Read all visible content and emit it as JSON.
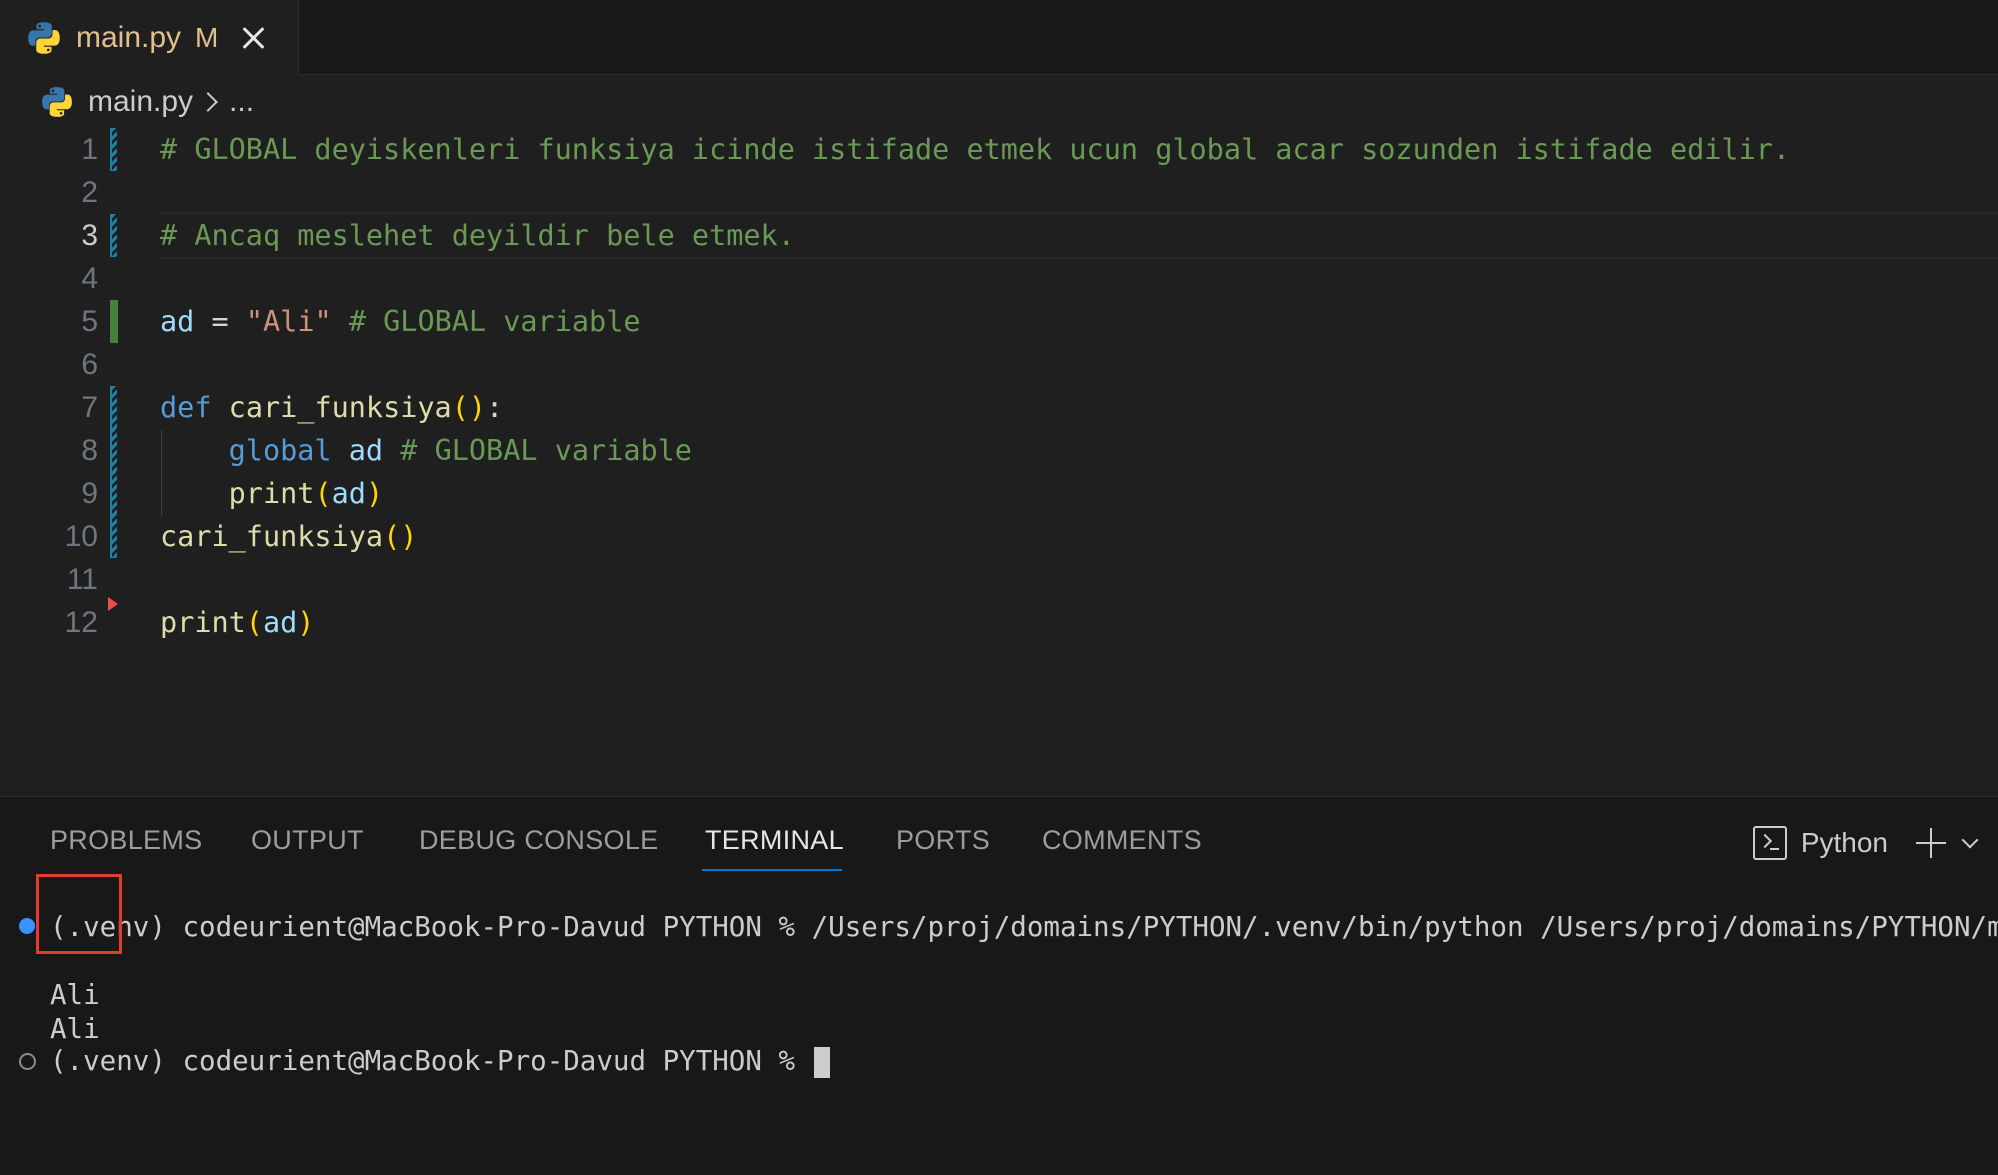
{
  "tab": {
    "filename": "main.py",
    "status": "M",
    "icon": "python-icon"
  },
  "breadcrumb": {
    "file": "main.py",
    "more": "..."
  },
  "editor": {
    "active_line": 3,
    "lines": [
      {
        "n": "1",
        "text": "# GLOBAL deyiskenleri funksiya icinde istifade etmek ucun global acar sozunden istifade edilir."
      },
      {
        "n": "2",
        "text": ""
      },
      {
        "n": "3",
        "text": "# Ancaq meslehet deyildir bele etmek."
      },
      {
        "n": "4",
        "text": ""
      },
      {
        "n": "5",
        "ad": "ad",
        "eq": "=",
        "str": "\"Ali\"",
        "comment": "# GLOBAL variable"
      },
      {
        "n": "6",
        "text": ""
      },
      {
        "n": "7",
        "kw": "def",
        "fn": "cari_funksiya",
        "parens": "()",
        "colon": ":"
      },
      {
        "n": "8",
        "kw": "global",
        "var": "ad",
        "comment": "# GLOBAL variable"
      },
      {
        "n": "9",
        "fn": "print",
        "open": "(",
        "var": "ad",
        "close": ")"
      },
      {
        "n": "10",
        "fn": "cari_funksiya",
        "parens": "()"
      },
      {
        "n": "11",
        "text": ""
      },
      {
        "n": "12",
        "fn": "print",
        "open": "(",
        "var": "ad",
        "close": ")"
      }
    ]
  },
  "panel": {
    "tabs": [
      "PROBLEMS",
      "OUTPUT",
      "DEBUG CONSOLE",
      "TERMINAL",
      "PORTS",
      "COMMENTS"
    ],
    "active_tab": "TERMINAL",
    "shell_label": "Python"
  },
  "terminal": {
    "command_line": "(.venv) codeurient@MacBook-Pro-Davud PYTHON % /Users/proj/domains/PYTHON/.venv/bin/python /Users/proj/domains/PYTHON/main.py",
    "output": [
      "Ali",
      "Ali"
    ],
    "prompt": "(.venv) codeurient@MacBook-Pro-Davud PYTHON % "
  },
  "colors": {
    "accent": "#0078d4",
    "comment": "#6a9955",
    "string": "#ce9178",
    "keyword": "#569cd6",
    "function": "#dcdcaa",
    "variable": "#9cdcfe",
    "highlight_box": "#e03c31"
  }
}
